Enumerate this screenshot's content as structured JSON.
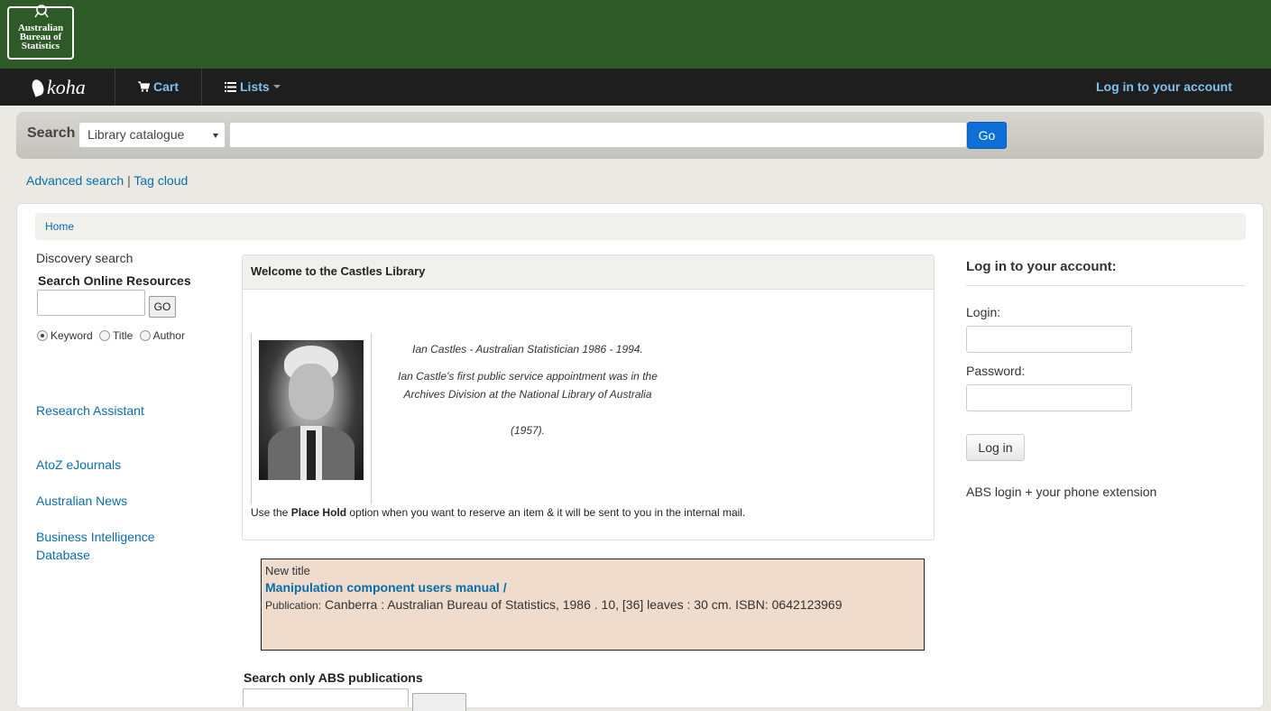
{
  "header": {
    "logo_lines": [
      "Australian",
      "Bureau of",
      "Statistics"
    ]
  },
  "navbar": {
    "brand": "koha",
    "cart": "Cart",
    "lists": "Lists",
    "login": "Log in to your account"
  },
  "search": {
    "label": "Search",
    "scope": "Library catalogue",
    "query": "",
    "go": "Go"
  },
  "sublinks": {
    "advanced": "Advanced search",
    "separator": "|",
    "tagcloud": "Tag cloud"
  },
  "breadcrumb": {
    "home": "Home"
  },
  "left": {
    "discovery": "Discovery search",
    "online_title": "Search Online Resources",
    "go": "GO",
    "radios": [
      "Keyword",
      "Title",
      "Author"
    ],
    "links": [
      "Research Assistant",
      "AtoZ eJournals",
      "Australian News",
      "Business Intelligence Database"
    ]
  },
  "welcome": {
    "heading": "Welcome to the Castles Library",
    "caption1": "Ian Castles - Australian Statistician 1986 - 1994.",
    "caption2": "Ian Castle's first public service appointment was in the Archives Division at the National Library of Australia",
    "caption3": "(1957).",
    "hold_pre": "Use the",
    "hold_bold": "Place Hold",
    "hold_post": "option when you want to reserve an item & it will be sent to you in the internal mail."
  },
  "new_title": {
    "label": "New title",
    "title": "Manipulation component users manual /",
    "pub_label": "Publication:",
    "pub_text": "Canberra : Australian Bureau of Statistics, 1986 . 10, [36] leaves : 30 cm. ISBN: 0642123969"
  },
  "abs_search": {
    "title": "Search only ABS publications"
  },
  "login": {
    "title": "Log in to your account:",
    "login_label": "Login:",
    "password_label": "Password:",
    "button": "Log in",
    "hint": "ABS login + your phone extension"
  }
}
